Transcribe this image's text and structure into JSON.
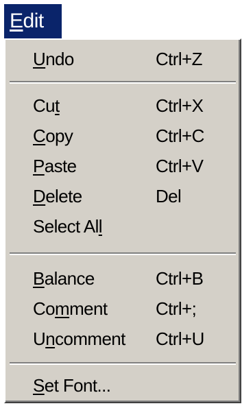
{
  "menubar": {
    "title_first": "E",
    "title_rest": "dit"
  },
  "menu": {
    "undo": {
      "l1": "",
      "acc": "U",
      "l2": "ndo",
      "shortcut": "Ctrl+Z"
    },
    "cut": {
      "l1": "Cu",
      "acc": "t",
      "l2": "",
      "shortcut": "Ctrl+X"
    },
    "copy": {
      "l1": "",
      "acc": "C",
      "l2": "opy",
      "shortcut": "Ctrl+C"
    },
    "paste": {
      "l1": "",
      "acc": "P",
      "l2": "aste",
      "shortcut": "Ctrl+V"
    },
    "delete": {
      "l1": "",
      "acc": "D",
      "l2": "elete",
      "shortcut": "Del"
    },
    "select_all": {
      "l1": "Select Al",
      "acc": "l",
      "l2": "",
      "shortcut": ""
    },
    "balance": {
      "l1": "",
      "acc": "B",
      "l2": "alance",
      "shortcut": "Ctrl+B"
    },
    "comment": {
      "l1": "Co",
      "acc": "m",
      "l2": "ment",
      "shortcut": "Ctrl+;"
    },
    "uncomment": {
      "l1": "U",
      "acc": "n",
      "l2": "comment",
      "shortcut": "Ctrl+U"
    },
    "set_font": {
      "l1": "",
      "acc": "S",
      "l2": "et Font...",
      "shortcut": ""
    }
  },
  "colors": {
    "menu_bg": "#d4d0c8",
    "highlight": "#0a246a",
    "text": "#000000"
  }
}
